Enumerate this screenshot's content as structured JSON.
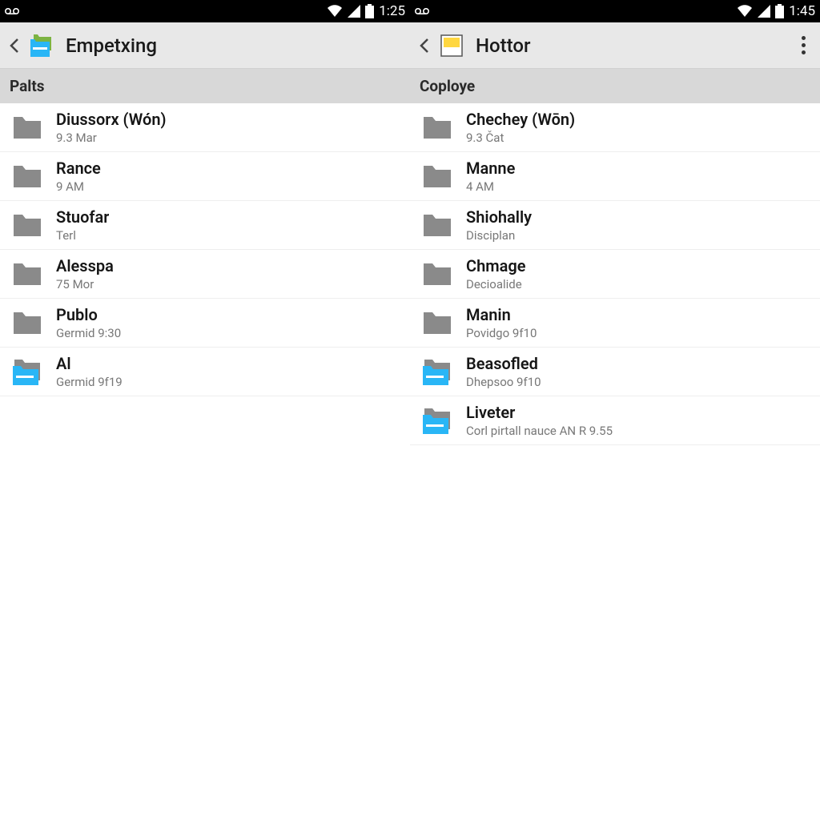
{
  "left": {
    "statusbar": {
      "time": "1:25"
    },
    "appbar": {
      "title": "Empetxing",
      "logo_style": "blue-green"
    },
    "section": "Palts",
    "items": [
      {
        "title": "Diussorx (Wón)",
        "sub": "9.3 Mar",
        "icon": "folder-gray"
      },
      {
        "title": "Rance",
        "sub": "9 AM",
        "icon": "folder-gray"
      },
      {
        "title": "Stuofar",
        "sub": "Terl",
        "icon": "folder-gray"
      },
      {
        "title": "Alesspa",
        "sub": "75 Mor",
        "icon": "folder-gray"
      },
      {
        "title": "Publo",
        "sub": "Germid 9:30",
        "icon": "folder-gray"
      },
      {
        "title": "Al",
        "sub": "Germid 9f19",
        "icon": "folder-blue"
      }
    ]
  },
  "right": {
    "statusbar": {
      "time": "1:45"
    },
    "appbar": {
      "title": "Hottor",
      "logo_style": "yellow-note",
      "overflow": true
    },
    "section": "Coploye",
    "items": [
      {
        "title": "Chechey (Wōn)",
        "sub": "9.3 Čat",
        "icon": "folder-gray"
      },
      {
        "title": "Manne",
        "sub": "4 AM",
        "icon": "folder-gray"
      },
      {
        "title": "Shiohally",
        "sub": "Disciplan",
        "icon": "folder-gray"
      },
      {
        "title": "Chmage",
        "sub": "Decioalide",
        "icon": "folder-gray"
      },
      {
        "title": "Manin",
        "sub": "Povidgo 9f10",
        "icon": "folder-gray"
      },
      {
        "title": "Beasofled",
        "sub": "Dhepsoo 9f10",
        "icon": "folder-blue"
      },
      {
        "title": "Liveter",
        "sub": "Corl pirtall nauce AN R 9.55",
        "icon": "folder-blue"
      }
    ]
  }
}
